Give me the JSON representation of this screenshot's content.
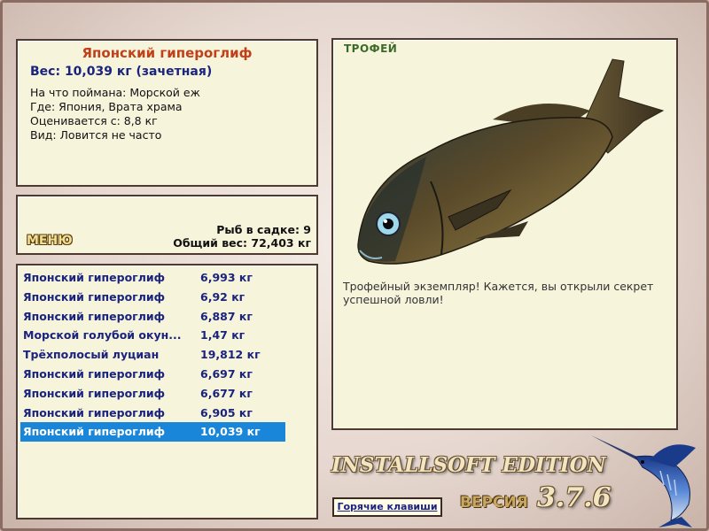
{
  "info": {
    "title": "Японский гипероглиф",
    "weight": "Вес: 10,039 кг (зачетная)",
    "rows": [
      "На что поймана: Морской еж",
      "Где: Япония, Врата храма",
      "Оценивается с: 8,8 кг",
      "Вид: Ловится не часто"
    ]
  },
  "menu": {
    "button_label": "МЕНЮ",
    "fish_count": "Рыб в садке: 9",
    "total_weight": "Общий вес: 72,403 кг"
  },
  "catch_list": [
    {
      "name": "Японский гипероглиф",
      "weight": "6,993 кг",
      "selected": false
    },
    {
      "name": "Японский гипероглиф",
      "weight": "6,92 кг",
      "selected": false
    },
    {
      "name": "Японский гипероглиф",
      "weight": "6,887 кг",
      "selected": false
    },
    {
      "name": "Морской голубой окун...",
      "weight": "1,47 кг",
      "selected": false
    },
    {
      "name": "Трёхполосый луциан",
      "weight": "19,812 кг",
      "selected": false
    },
    {
      "name": "Японский гипероглиф",
      "weight": "6,697 кг",
      "selected": false
    },
    {
      "name": "Японский гипероглиф",
      "weight": "6,677 кг",
      "selected": false
    },
    {
      "name": "Японский гипероглиф",
      "weight": "6,905 кг",
      "selected": false
    },
    {
      "name": "Японский гипероглиф",
      "weight": "10,039 кг",
      "selected": true
    }
  ],
  "trophy": {
    "label": "ТРОФЕЙ",
    "message": "Трофейный экземпляр! Кажется, вы открыли секрет успешной ловли!",
    "image_icon": "fish-image"
  },
  "branding": {
    "edition": "INSTALLSOFT EDITION",
    "version_label": "ВЕРСИЯ",
    "version_number": "3.7.6",
    "logo_icon": "marlin-icon"
  },
  "hotkeys_label": "Горячие клавиши",
  "colors": {
    "panel_bg": "#f7f4dc",
    "panel_border": "#4e3a32",
    "title_orange": "#c0401a",
    "navy_text": "#1a237e",
    "selection_blue": "#1a86d9",
    "trophy_green": "#3a6a2a"
  }
}
